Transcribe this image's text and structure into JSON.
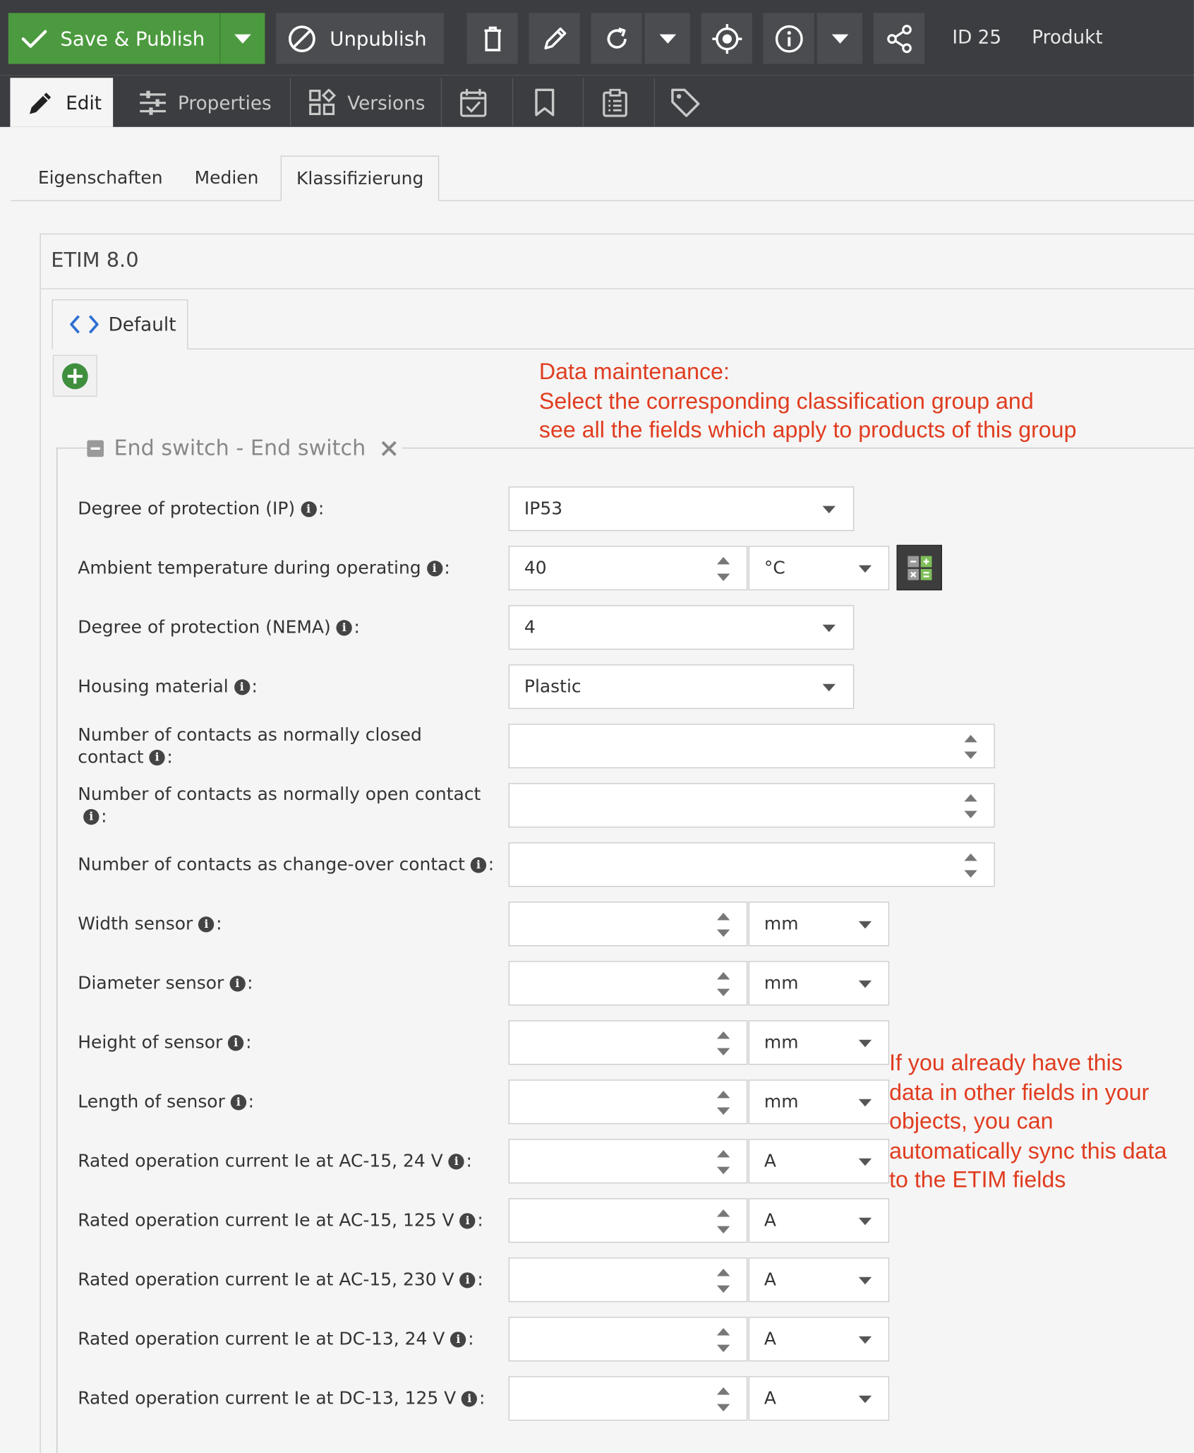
{
  "toolbar": {
    "save_publish": "Save & Publish",
    "unpublish": "Unpublish",
    "id_label": "ID 25",
    "type_label": "Produkt"
  },
  "tabs": [
    {
      "label": "Edit",
      "icon": "pencil-icon"
    },
    {
      "label": "Properties",
      "icon": "sliders-icon"
    },
    {
      "label": "Versions",
      "icon": "versions-icon"
    }
  ],
  "tab_icons": [
    "calendar-check-icon",
    "bookmark-icon",
    "clipboard-list-icon",
    "tag-icon"
  ],
  "subtabs": [
    "Eigenschaften",
    "Medien",
    "Klassifizierung"
  ],
  "panel": {
    "title": "ETIM 8.0",
    "inner_tab": "Default",
    "group_title": "End switch - End switch"
  },
  "fields": [
    {
      "label": "Degree of protection (IP)",
      "kind": "select",
      "value": "IP53"
    },
    {
      "label": "Ambient temperature during operating",
      "kind": "quantity",
      "value": "40",
      "unit": "°C",
      "calculator": true
    },
    {
      "label": "Degree of protection (NEMA)",
      "kind": "select",
      "value": "4"
    },
    {
      "label": "Housing material",
      "kind": "select",
      "value": "Plastic"
    },
    {
      "label": "Number of contacts as normally closed contact",
      "kind": "number",
      "value": ""
    },
    {
      "label": "Number of contacts as normally open contact",
      "kind": "number",
      "value": ""
    },
    {
      "label": "Number of contacts as change-over contact",
      "kind": "number",
      "value": ""
    },
    {
      "label": "Width sensor",
      "kind": "quantity",
      "value": "",
      "unit": "mm"
    },
    {
      "label": "Diameter sensor",
      "kind": "quantity",
      "value": "",
      "unit": "mm"
    },
    {
      "label": "Height of sensor",
      "kind": "quantity",
      "value": "",
      "unit": "mm"
    },
    {
      "label": "Length of sensor",
      "kind": "quantity",
      "value": "",
      "unit": "mm"
    },
    {
      "label": "Rated operation current Ie at AC-15, 24 V",
      "kind": "quantity",
      "value": "",
      "unit": "A"
    },
    {
      "label": "Rated operation current Ie at AC-15, 125 V",
      "kind": "quantity",
      "value": "",
      "unit": "A"
    },
    {
      "label": "Rated operation current Ie at AC-15, 230 V",
      "kind": "quantity",
      "value": "",
      "unit": "A"
    },
    {
      "label": "Rated operation current Ie at DC-13, 24 V",
      "kind": "quantity",
      "value": "",
      "unit": "A"
    },
    {
      "label": "Rated operation current Ie at DC-13, 125 V",
      "kind": "quantity",
      "value": "",
      "unit": "A"
    }
  ],
  "annotations": {
    "top": [
      "Data maintenance:",
      "Select the corresponding classification group and",
      "see all the fields which apply to products of this group"
    ],
    "side": [
      "If you already have this",
      "data in other fields in your",
      "objects, you can",
      "automatically sync this data",
      "to the ETIM fields"
    ]
  },
  "colors": {
    "toolbar_bg": "#3b3d40",
    "save_green": "#4c9a3f",
    "annotation_red": "#e03c1f",
    "add_green": "#3f8f3f"
  }
}
